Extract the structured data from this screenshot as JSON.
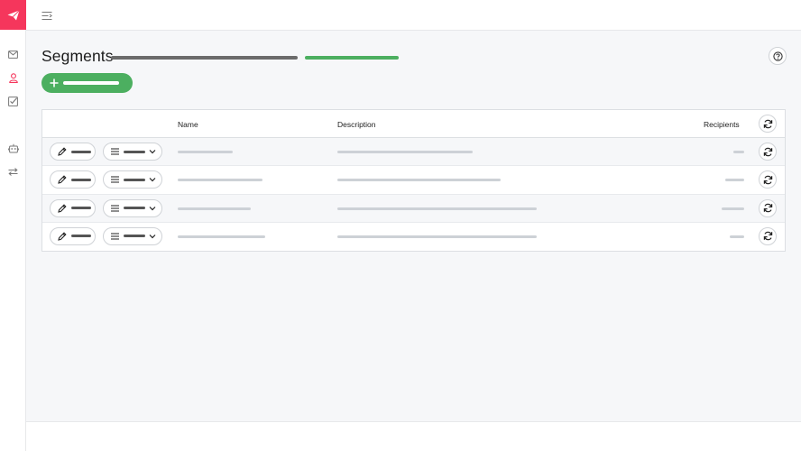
{
  "app": {
    "icons": {
      "logo": "paper-plane-icon",
      "menu_toggle": "menu-toggle-icon",
      "nav": [
        "mail-icon",
        "user-icon",
        "checkbox-icon",
        "robot-icon",
        "transfer-icon"
      ]
    },
    "colors": {
      "brand": "#f5365c",
      "accent_green": "#4caf60",
      "nav_active": "#f5365c"
    }
  },
  "page": {
    "title": "Segments"
  },
  "table": {
    "columns": {
      "name": "Name",
      "description": "Description",
      "recipients": "Recipients"
    },
    "rows": [
      {},
      {},
      {},
      {}
    ]
  }
}
